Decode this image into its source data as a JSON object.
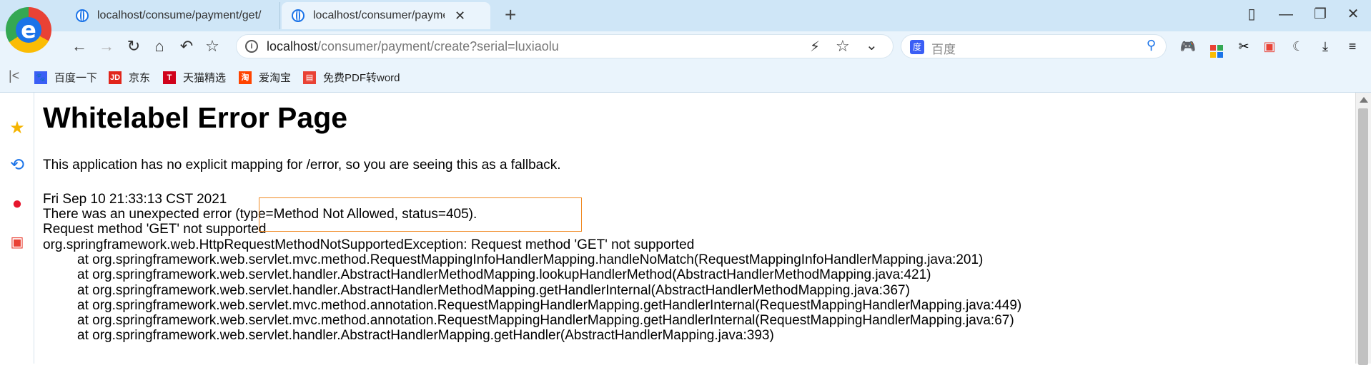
{
  "tabs": [
    {
      "title": "localhost/consume/payment/get/"
    },
    {
      "title": "localhost/consumer/payment/",
      "close": "✕"
    }
  ],
  "new_tab_symbol": "+",
  "window_controls": {
    "sidebar": "▯",
    "minimize": "—",
    "restore": "❐",
    "close": "✕"
  },
  "nav": {
    "back": "←",
    "forward": "→",
    "reload": "↻",
    "home": "⌂",
    "undo": "↶",
    "bookmark": "☆"
  },
  "address": {
    "host": "localhost",
    "path": "/consumer/payment/create?serial=luxiaolu"
  },
  "search": {
    "placeholder": "百度",
    "engine_icon": "baidu-paw-icon"
  },
  "bookmarks": [
    {
      "label": "百度一下",
      "icon": "baidu-icon",
      "icon_text": "",
      "color": "#3a5ef5"
    },
    {
      "label": "京东",
      "icon": "jd-icon",
      "icon_text": "JD",
      "color": "#e1251b"
    },
    {
      "label": "天猫精选",
      "icon": "tmall-icon",
      "icon_text": "T",
      "color": "#d0021b"
    },
    {
      "label": "爱淘宝",
      "icon": "taobao-icon",
      "icon_text": "淘",
      "color": "#ff4400"
    },
    {
      "label": "免费PDF转word",
      "icon": "pdf-icon",
      "icon_text": "",
      "color": "#e94235"
    }
  ],
  "page": {
    "title": "Whitelabel Error Page",
    "description": "This application has no explicit mapping for /error, so you are seeing this as a fallback.",
    "timestamp": "Fri Sep 10 21:33:13 CST 2021",
    "error_line": "There was an unexpected error (type=Method Not Allowed, status=405).",
    "message": "Request method 'GET' not supported",
    "exception": "org.springframework.web.HttpRequestMethodNotSupportedException: Request method 'GET' not supported",
    "stack": [
      "at org.springframework.web.servlet.mvc.method.RequestMappingInfoHandlerMapping.handleNoMatch(RequestMappingInfoHandlerMapping.java:201)",
      "at org.springframework.web.servlet.handler.AbstractHandlerMethodMapping.lookupHandlerMethod(AbstractHandlerMethodMapping.java:421)",
      "at org.springframework.web.servlet.handler.AbstractHandlerMethodMapping.getHandlerInternal(AbstractHandlerMethodMapping.java:367)",
      "at org.springframework.web.servlet.mvc.method.annotation.RequestMappingHandlerMapping.getHandlerInternal(RequestMappingHandlerMapping.java:449)",
      "at org.springframework.web.servlet.mvc.method.annotation.RequestMappingHandlerMapping.getHandlerInternal(RequestMappingHandlerMapping.java:67)",
      "at org.springframework.web.servlet.handler.AbstractHandlerMapping.getHandler(AbstractHandlerMapping.java:393)"
    ]
  },
  "colors": {
    "highlight_border": "#f08a24",
    "tab_strip": "#cfe6f7",
    "toolbar": "#eaf4fc"
  }
}
